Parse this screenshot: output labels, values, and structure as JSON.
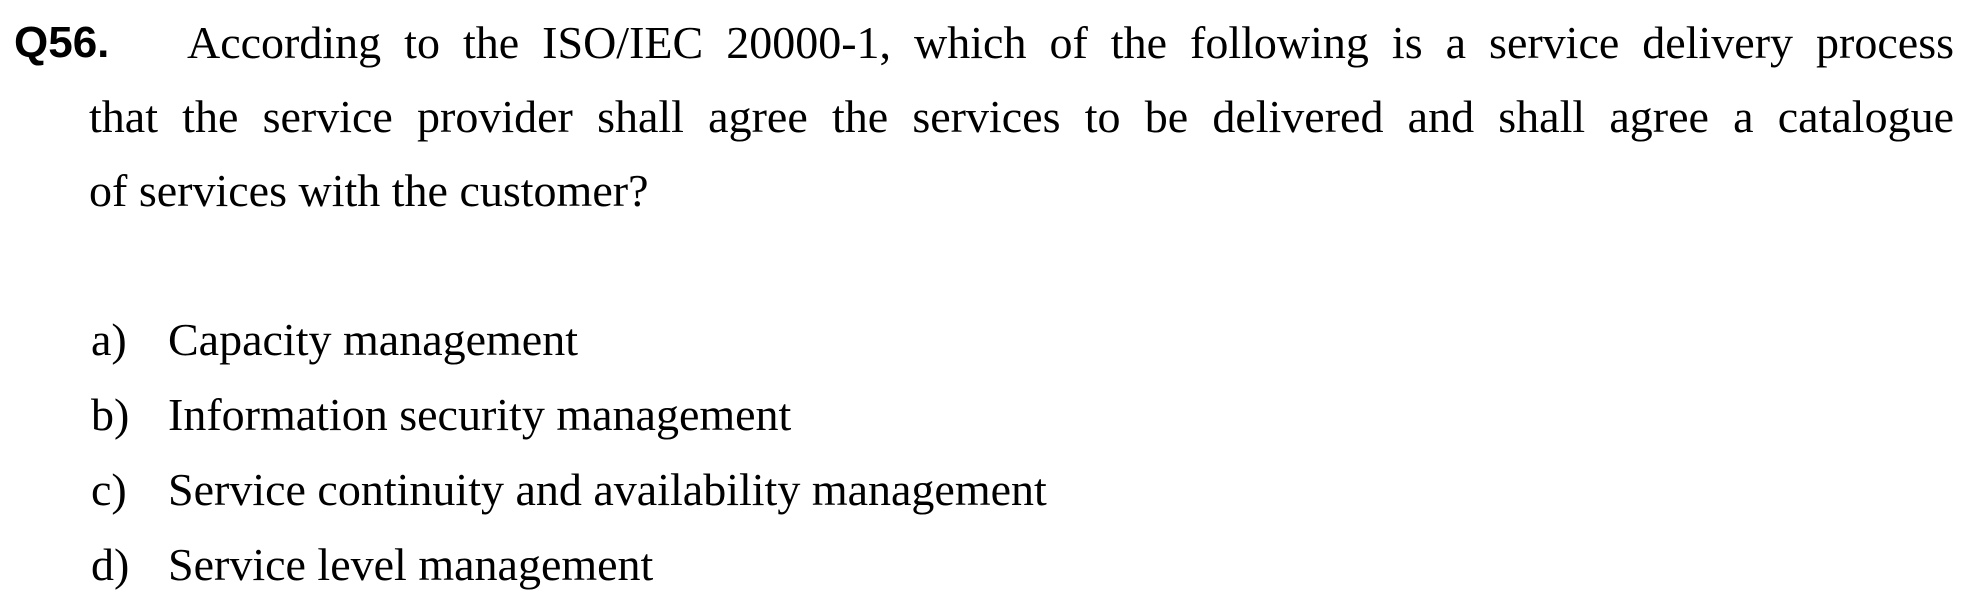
{
  "question": {
    "number": "Q56.",
    "lines": [
      "According to the ISO/IEC 20000-1, which of the following is a service delivery process",
      "that the service provider shall agree the services to be delivered and shall agree a catalogue",
      "of services with the customer?"
    ]
  },
  "options": [
    {
      "letter": "a)",
      "text": "Capacity management"
    },
    {
      "letter": "b)",
      "text": "Information security management"
    },
    {
      "letter": "c)",
      "text": "Service continuity and availability management"
    },
    {
      "letter": "d)",
      "text": "Service level management"
    }
  ]
}
